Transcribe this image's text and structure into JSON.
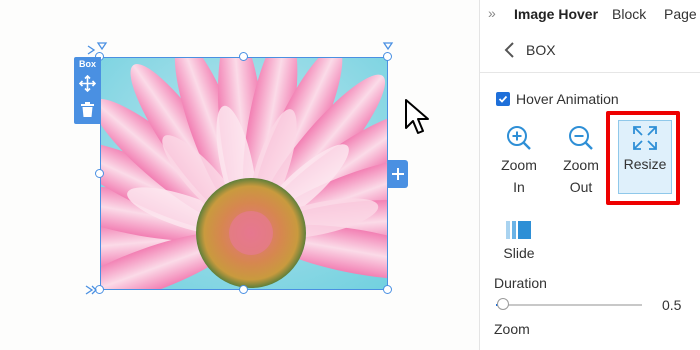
{
  "panel": {
    "tabs": [
      "Image Hover",
      "Block",
      "Page"
    ],
    "back_label": "BOX",
    "hover_animation_label": "Hover Animation",
    "hover_animation_checked": true,
    "animations": [
      {
        "label_line1": "Zoom",
        "label_line2": "In",
        "icon": "zoom-in-icon"
      },
      {
        "label_line1": "Zoom",
        "label_line2": "Out",
        "icon": "zoom-out-icon"
      },
      {
        "label_line1": "Resize",
        "label_line2": "",
        "icon": "resize-icon",
        "selected": true
      },
      {
        "label_line1": "Slide",
        "label_line2": "",
        "icon": "slide-icon"
      }
    ],
    "duration_label": "Duration",
    "duration_value": "0.5",
    "duration_slider_fraction": 0.05,
    "zoom_label": "Zoom"
  },
  "canvas": {
    "toolbar_label": "Box",
    "image_subject": "pink-daisy-flower"
  },
  "colors": {
    "accent": "#4a90e2",
    "checkbox": "#1e6fd9",
    "highlight": "#ee0000",
    "selected_bg": "#dff0fb"
  }
}
